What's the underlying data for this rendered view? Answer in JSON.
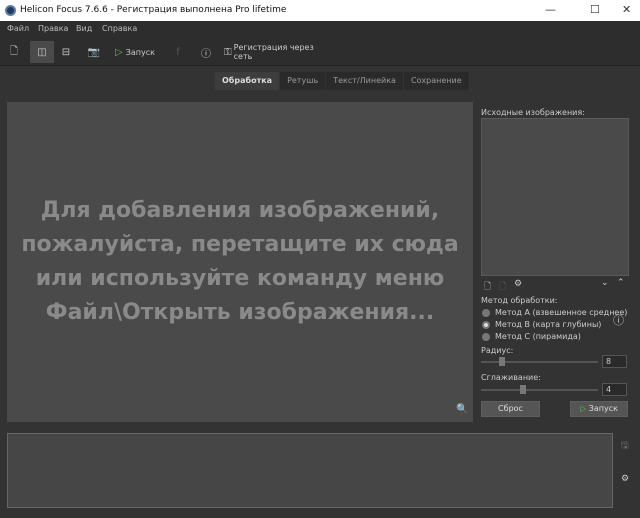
{
  "window": {
    "title": "Helicon Focus 7.6.6 - Регистрация выполнена Pro lifetime"
  },
  "menu": [
    "Файл",
    "Правка",
    "Вид",
    "Справка"
  ],
  "toolbar": {
    "run_label": "Запуск",
    "register_label": "Регистрация через сеть"
  },
  "tabs": [
    "Обработка",
    "Ретушь",
    "Текст/Линейка",
    "Сохранение"
  ],
  "canvas": {
    "message_lines": [
      "Для добавления изображений,",
      "пожалуйста, перетащите их сюда",
      "или используйте команду меню",
      "Файл\\Открыть изображения..."
    ]
  },
  "panel": {
    "source_label": "Исходные изображения:",
    "method_label": "Метод обработки:",
    "methods": [
      {
        "label": "Метод A (взвешенное среднее)",
        "selected": false
      },
      {
        "label": "Метод B (карта глубины)",
        "selected": true
      },
      {
        "label": "Метод C (пирамида)",
        "selected": false
      }
    ],
    "radius_label": "Радиус:",
    "radius_value": "8",
    "smoothing_label": "Сглаживание:",
    "smoothing_value": "4",
    "reset_label": "Сброс",
    "run_label": "Запуск"
  },
  "colors": {
    "run_accent": "#5cb85c"
  }
}
